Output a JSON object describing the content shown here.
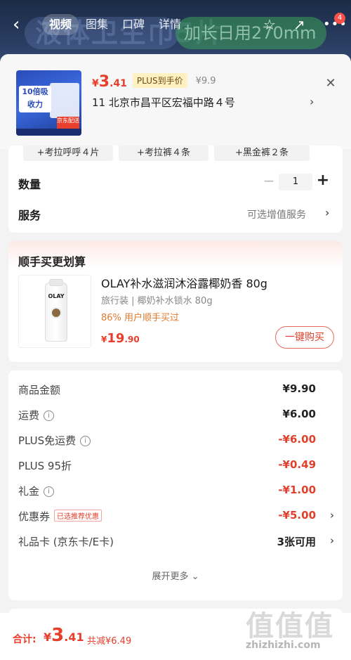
{
  "header": {
    "tabs": [
      {
        "label": "视频",
        "active": true
      },
      {
        "label": "图集",
        "active": false
      },
      {
        "label": "口碑",
        "active": false
      },
      {
        "label": "详情",
        "active": false
      }
    ],
    "banner_text": "液体卫生巾5片",
    "banner_text2": "加长日用270mm",
    "cart_badge": "4"
  },
  "product": {
    "thumb_text": "10倍吸收力",
    "thumb_tag": "京东配送",
    "price_yen": "¥",
    "price_int": "3",
    "price_dec": ".41",
    "plus_tag": "PLUS到手价",
    "orig_price": "¥9.9",
    "address": "11  北京市昌平区宏福中路４号"
  },
  "options": {
    "chips": [
      "+考拉呼呼４片",
      "+考拉裤４条",
      "+黑金裤２条"
    ],
    "qty_label": "数量",
    "qty_value": "1",
    "service_label": "服务",
    "service_value": "可选增值服务"
  },
  "combo": {
    "title": "顺手买更划算",
    "bottle_logo": "OLAY",
    "name": "OLAY补水滋润沐浴露椰奶香 80g",
    "sub": "旅行装 | 椰奶补水锁水 80g",
    "pct": "86% 用户顺手买过",
    "price_yen": "¥",
    "price_int": "19",
    "price_dec": ".90",
    "buy_label": "一键购买"
  },
  "detail": {
    "rows": [
      {
        "label": "商品金额",
        "value": "¥9.90"
      },
      {
        "label": "运费",
        "value": "¥6.00"
      },
      {
        "label": "PLUS免运费",
        "value": "-¥6.00"
      },
      {
        "label": "PLUS 95折",
        "value": "-¥0.49"
      },
      {
        "label": "礼金",
        "value": "-¥1.00"
      },
      {
        "label": "优惠券",
        "value": "-¥5.00",
        "tag": "已选推荐优惠"
      },
      {
        "label": "礼品卡 (京东卡/E卡)",
        "value": "3张可用"
      }
    ],
    "expand": "展开更多"
  },
  "footer": {
    "total_label": "合计:",
    "total_yen": "¥",
    "total_int": "3",
    "total_dec": ".41",
    "saved": "共减¥6.49"
  },
  "watermark": {
    "logo": "值值值",
    "text": "zhizhizhi.com"
  },
  "colors": {
    "accent_red": "#e83e2c",
    "plus_gold": "#fff1c2",
    "pct_orange": "#e07a2e"
  }
}
